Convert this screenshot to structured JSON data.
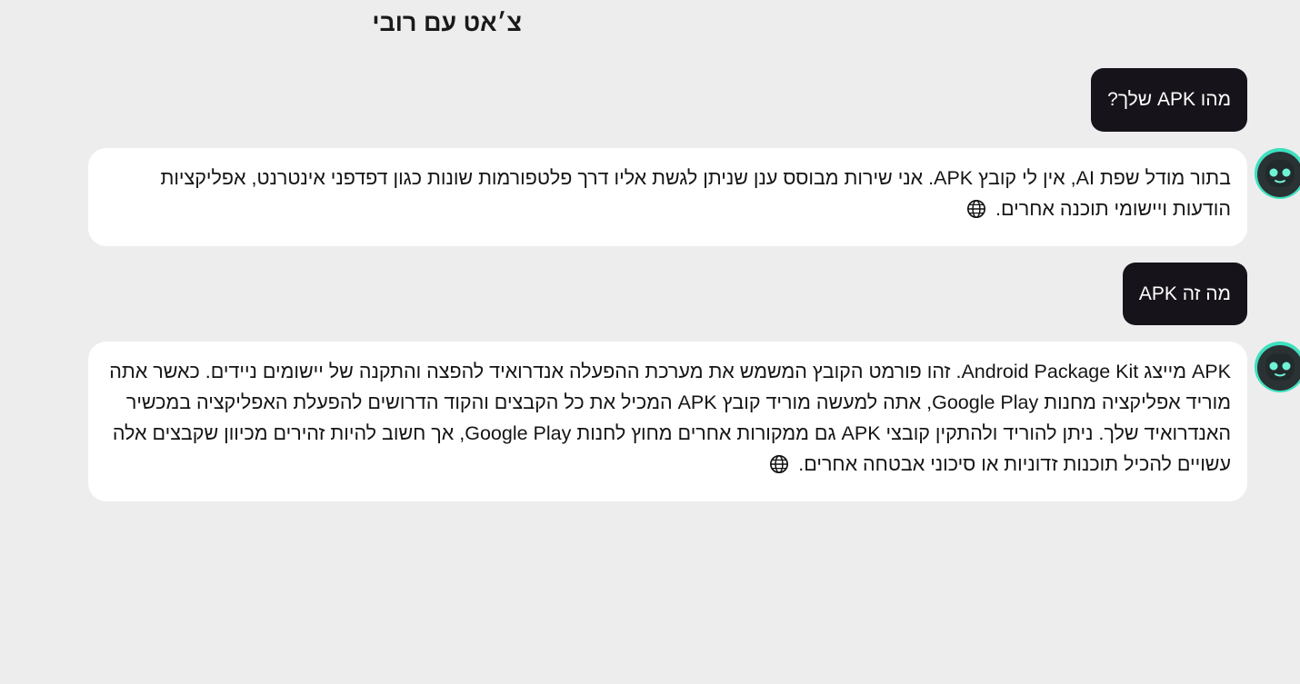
{
  "header": {
    "title": "צ׳אט עם רובי"
  },
  "conversation": {
    "messages": [
      {
        "role": "user",
        "text": "מהו APK שלך?"
      },
      {
        "role": "assistant",
        "text": "בתור מודל שפת AI, אין לי קובץ APK. אני שירות מבוסס ענן שניתן לגשת אליו דרך פלטפורמות שונות כגון דפדפני אינטרנט, אפליקציות הודעות ויישומי תוכנה אחרים.",
        "icon": "globe-icon"
      },
      {
        "role": "user",
        "text": "מה זה APK"
      },
      {
        "role": "assistant",
        "text": "APK מייצג Android Package Kit. זהו פורמט הקובץ המשמש את מערכת ההפעלה אנדרואיד להפצה והתקנה של יישומים ניידים. כאשר אתה מוריד אפליקציה מחנות Google Play, אתה למעשה מוריד קובץ APK המכיל את כל הקבצים והקוד הדרושים להפעלת האפליקציה במכשיר האנדרואיד שלך. ניתן להוריד ולהתקין קובצי APK גם ממקורות אחרים מחוץ לחנות Google Play, אך חשוב להיות זהירים מכיוון שקבצים אלה עשויים להכיל תוכנות זדוניות או סיכוני אבטחה אחרים.",
        "icon": "globe-icon"
      }
    ]
  },
  "colors": {
    "background": "#ededed",
    "user_bubble": "#16131a",
    "bot_bubble": "#ffffff",
    "avatar_accent": "#3fe0bf"
  }
}
